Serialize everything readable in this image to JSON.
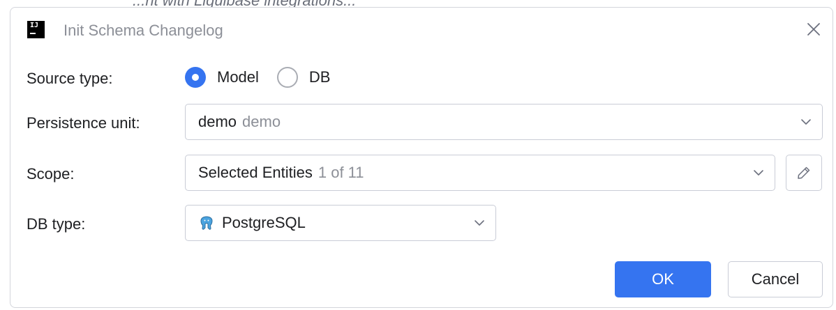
{
  "background": {
    "partial_text": "...nt with Liquibase integrations..."
  },
  "dialog": {
    "title": "Init Schema Changelog",
    "app_icon": "intellij-icon",
    "close_icon": "close-icon"
  },
  "form": {
    "source_type": {
      "label": "Source type:",
      "options": [
        {
          "label": "Model",
          "selected": true
        },
        {
          "label": "DB",
          "selected": false
        }
      ]
    },
    "persistence_unit": {
      "label": "Persistence unit:",
      "value": "demo",
      "hint": "demo"
    },
    "scope": {
      "label": "Scope:",
      "value": "Selected Entities",
      "hint": "1 of 11",
      "edit_icon": "pencil-icon"
    },
    "db_type": {
      "label": "DB type:",
      "value": "PostgreSQL",
      "icon": "postgresql-icon"
    }
  },
  "buttons": {
    "ok": "OK",
    "cancel": "Cancel"
  },
  "colors": {
    "accent": "#3574f0",
    "border": "#c9ccd6",
    "hint": "#8c8f97",
    "text": "#1e1f22"
  }
}
